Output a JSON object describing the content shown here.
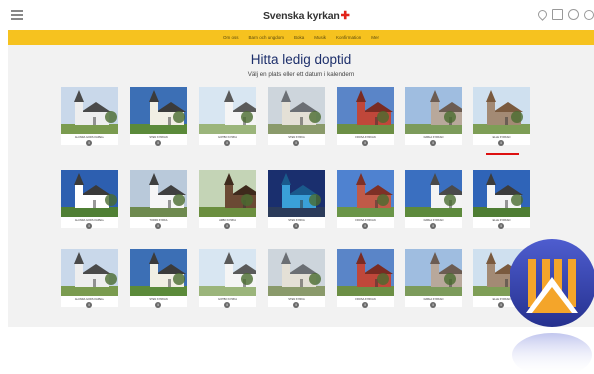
{
  "header": {
    "brand": "Svenska kyrkan",
    "brand_mark": "✚",
    "icons": [
      "menu-icon",
      "location-pin-icon",
      "calendar-icon",
      "chat-icon",
      "search-icon"
    ]
  },
  "nav": {
    "items": [
      "Om oss",
      "Barn och ungdom",
      "Boka",
      "Musik",
      "Konfirmation",
      "Mer"
    ]
  },
  "page": {
    "title": "Hitta ledig doptid",
    "subtitle": "Välj en plats eller ett datum i kalendern"
  },
  "churches": [
    {
      "caption": "ALUNDA GODS KAPELL"
    },
    {
      "caption": "STEN KYRKAN"
    },
    {
      "caption": "GOTBO KYRKA"
    },
    {
      "caption": "STEN KYRKA"
    },
    {
      "caption": "FRÖSA KYRKAN"
    },
    {
      "caption": "DABLA KYRKAN"
    },
    {
      "caption": "ELLE KYRKAN"
    },
    {
      "caption": "ALUNDA GODS KAPELL"
    },
    {
      "caption": "TORPA KYRKA"
    },
    {
      "caption": "ÄRBO KYRKA"
    },
    {
      "caption": "STEN KYRKA"
    },
    {
      "caption": "FRÖSA KYRKAN"
    },
    {
      "caption": "DABLA KYRKAN"
    },
    {
      "caption": "ELLE KYRKAN"
    },
    {
      "caption": "ALUNDA GODS KAPELL"
    },
    {
      "caption": "STEN KYRKAN"
    },
    {
      "caption": "GOTBO KYRKA"
    },
    {
      "caption": "STEN KYRKA"
    },
    {
      "caption": "FRÖSA KYRKAN"
    },
    {
      "caption": "DABLA KYRKAN"
    },
    {
      "caption": "ELLE KYRKAN"
    }
  ],
  "colors": {
    "accent_yellow": "#f6c21f",
    "title_blue": "#1d2f6b",
    "selected_red": "#dd1111",
    "brand_red": "#e2231a"
  }
}
